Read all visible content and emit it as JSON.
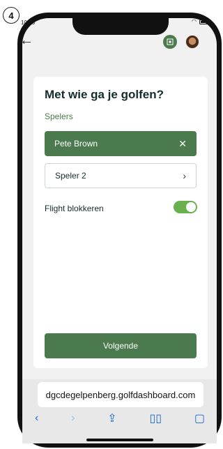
{
  "step": {
    "number": "4"
  },
  "status_bar": {
    "time": "10:05"
  },
  "header": {
    "back_icon": "arrow-left-icon",
    "scan_icon": "scan-icon",
    "avatar": "avatar"
  },
  "form": {
    "title": "Met wie ga je golfen?",
    "subtitle": "Spelers",
    "players": [
      {
        "label": "Pete Brown",
        "selected": true
      },
      {
        "label": "Speler 2",
        "selected": false
      }
    ],
    "flight": {
      "label": "Flight blokkeren",
      "enabled": true
    },
    "next_label": "Volgende"
  },
  "browser": {
    "url": "dgcdegelpenberg.golfdashboard.com"
  },
  "colors": {
    "primary": "#4c7a4f",
    "toggle": "#6ab04c",
    "text": "#162b2b",
    "link": "#1a66d6"
  }
}
